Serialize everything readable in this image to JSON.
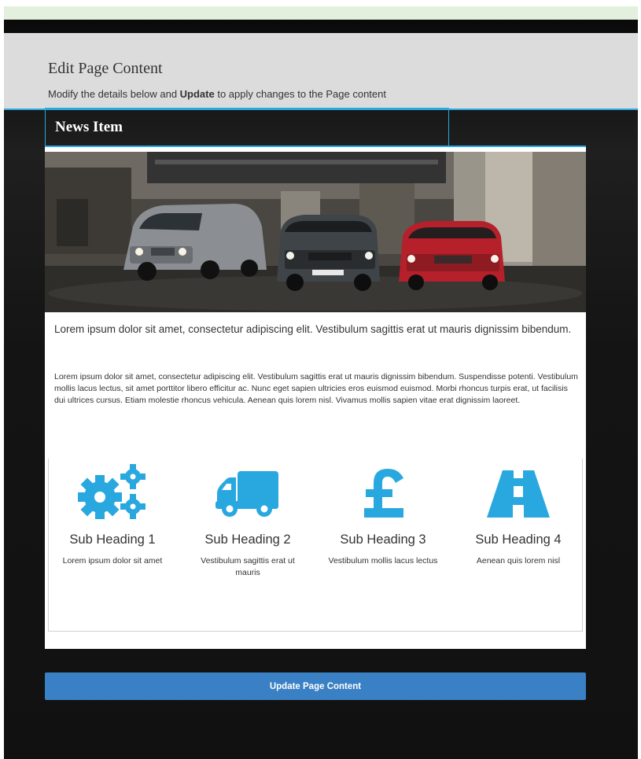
{
  "header": {
    "title": "Edit Page Content",
    "subtitle_pre": "Modify the details below and ",
    "subtitle_bold": "Update",
    "subtitle_post": " to apply changes to the Page content"
  },
  "news": {
    "tab_label": "News Item",
    "lead": "Lorem ipsum dolor sit amet, consectetur adipiscing elit. Vestibulum sagittis erat ut mauris dignissim bibendum.",
    "body": "Lorem ipsum dolor sit amet, consectetur adipiscing elit. Vestibulum sagittis erat ut mauris dignissim bibendum. Suspendisse potenti. Vestibulum mollis lacus lectus, sit amet porttitor libero efficitur ac. Nunc eget sapien ultricies eros euismod euismod. Morbi rhoncus turpis erat, ut facilisis dui ultrices cursus. Etiam molestie rhoncus vehicula. Aenean quis lorem nisl. Vivamus mollis sapien vitae erat dignissim laoreet."
  },
  "features": [
    {
      "icon": "gears-icon",
      "heading": "Sub Heading 1",
      "text": "Lorem ipsum dolor sit amet"
    },
    {
      "icon": "truck-icon",
      "heading": "Sub Heading 2",
      "text": "Vestibulum sagittis erat ut mauris"
    },
    {
      "icon": "pound-icon",
      "heading": "Sub Heading 3",
      "text": "Vestibulum mollis lacus lectus"
    },
    {
      "icon": "road-icon",
      "heading": "Sub Heading 4",
      "text": "Aenean quis lorem nisl"
    }
  ],
  "update_button": "Update Page Content",
  "colors": {
    "accent": "#29a8e0",
    "button": "#3a80c4",
    "icon": "#29a8e0"
  }
}
